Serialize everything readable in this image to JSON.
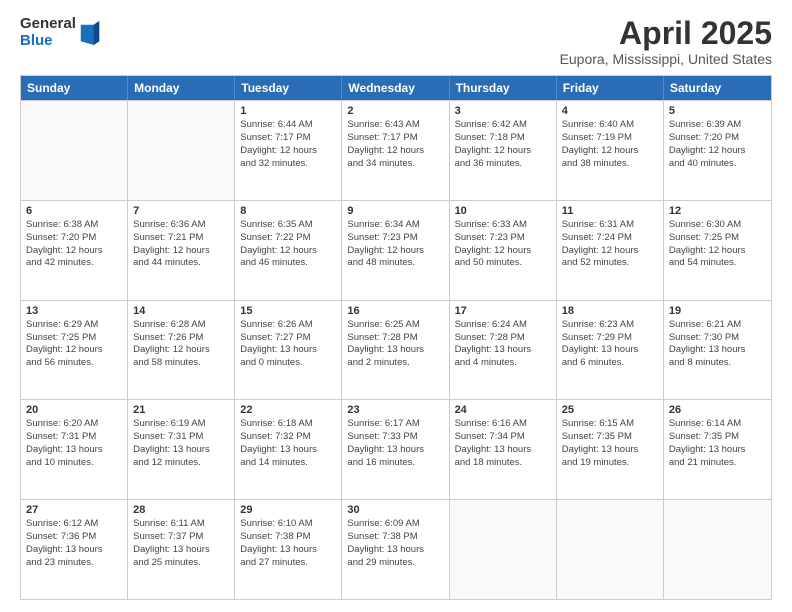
{
  "header": {
    "logo_general": "General",
    "logo_blue": "Blue",
    "title": "April 2025",
    "subtitle": "Eupora, Mississippi, United States"
  },
  "calendar": {
    "days_of_week": [
      "Sunday",
      "Monday",
      "Tuesday",
      "Wednesday",
      "Thursday",
      "Friday",
      "Saturday"
    ],
    "rows": [
      [
        {
          "day": "",
          "info": ""
        },
        {
          "day": "",
          "info": ""
        },
        {
          "day": "1",
          "info": "Sunrise: 6:44 AM\nSunset: 7:17 PM\nDaylight: 12 hours\nand 32 minutes."
        },
        {
          "day": "2",
          "info": "Sunrise: 6:43 AM\nSunset: 7:17 PM\nDaylight: 12 hours\nand 34 minutes."
        },
        {
          "day": "3",
          "info": "Sunrise: 6:42 AM\nSunset: 7:18 PM\nDaylight: 12 hours\nand 36 minutes."
        },
        {
          "day": "4",
          "info": "Sunrise: 6:40 AM\nSunset: 7:19 PM\nDaylight: 12 hours\nand 38 minutes."
        },
        {
          "day": "5",
          "info": "Sunrise: 6:39 AM\nSunset: 7:20 PM\nDaylight: 12 hours\nand 40 minutes."
        }
      ],
      [
        {
          "day": "6",
          "info": "Sunrise: 6:38 AM\nSunset: 7:20 PM\nDaylight: 12 hours\nand 42 minutes."
        },
        {
          "day": "7",
          "info": "Sunrise: 6:36 AM\nSunset: 7:21 PM\nDaylight: 12 hours\nand 44 minutes."
        },
        {
          "day": "8",
          "info": "Sunrise: 6:35 AM\nSunset: 7:22 PM\nDaylight: 12 hours\nand 46 minutes."
        },
        {
          "day": "9",
          "info": "Sunrise: 6:34 AM\nSunset: 7:23 PM\nDaylight: 12 hours\nand 48 minutes."
        },
        {
          "day": "10",
          "info": "Sunrise: 6:33 AM\nSunset: 7:23 PM\nDaylight: 12 hours\nand 50 minutes."
        },
        {
          "day": "11",
          "info": "Sunrise: 6:31 AM\nSunset: 7:24 PM\nDaylight: 12 hours\nand 52 minutes."
        },
        {
          "day": "12",
          "info": "Sunrise: 6:30 AM\nSunset: 7:25 PM\nDaylight: 12 hours\nand 54 minutes."
        }
      ],
      [
        {
          "day": "13",
          "info": "Sunrise: 6:29 AM\nSunset: 7:25 PM\nDaylight: 12 hours\nand 56 minutes."
        },
        {
          "day": "14",
          "info": "Sunrise: 6:28 AM\nSunset: 7:26 PM\nDaylight: 12 hours\nand 58 minutes."
        },
        {
          "day": "15",
          "info": "Sunrise: 6:26 AM\nSunset: 7:27 PM\nDaylight: 13 hours\nand 0 minutes."
        },
        {
          "day": "16",
          "info": "Sunrise: 6:25 AM\nSunset: 7:28 PM\nDaylight: 13 hours\nand 2 minutes."
        },
        {
          "day": "17",
          "info": "Sunrise: 6:24 AM\nSunset: 7:28 PM\nDaylight: 13 hours\nand 4 minutes."
        },
        {
          "day": "18",
          "info": "Sunrise: 6:23 AM\nSunset: 7:29 PM\nDaylight: 13 hours\nand 6 minutes."
        },
        {
          "day": "19",
          "info": "Sunrise: 6:21 AM\nSunset: 7:30 PM\nDaylight: 13 hours\nand 8 minutes."
        }
      ],
      [
        {
          "day": "20",
          "info": "Sunrise: 6:20 AM\nSunset: 7:31 PM\nDaylight: 13 hours\nand 10 minutes."
        },
        {
          "day": "21",
          "info": "Sunrise: 6:19 AM\nSunset: 7:31 PM\nDaylight: 13 hours\nand 12 minutes."
        },
        {
          "day": "22",
          "info": "Sunrise: 6:18 AM\nSunset: 7:32 PM\nDaylight: 13 hours\nand 14 minutes."
        },
        {
          "day": "23",
          "info": "Sunrise: 6:17 AM\nSunset: 7:33 PM\nDaylight: 13 hours\nand 16 minutes."
        },
        {
          "day": "24",
          "info": "Sunrise: 6:16 AM\nSunset: 7:34 PM\nDaylight: 13 hours\nand 18 minutes."
        },
        {
          "day": "25",
          "info": "Sunrise: 6:15 AM\nSunset: 7:35 PM\nDaylight: 13 hours\nand 19 minutes."
        },
        {
          "day": "26",
          "info": "Sunrise: 6:14 AM\nSunset: 7:35 PM\nDaylight: 13 hours\nand 21 minutes."
        }
      ],
      [
        {
          "day": "27",
          "info": "Sunrise: 6:12 AM\nSunset: 7:36 PM\nDaylight: 13 hours\nand 23 minutes."
        },
        {
          "day": "28",
          "info": "Sunrise: 6:11 AM\nSunset: 7:37 PM\nDaylight: 13 hours\nand 25 minutes."
        },
        {
          "day": "29",
          "info": "Sunrise: 6:10 AM\nSunset: 7:38 PM\nDaylight: 13 hours\nand 27 minutes."
        },
        {
          "day": "30",
          "info": "Sunrise: 6:09 AM\nSunset: 7:38 PM\nDaylight: 13 hours\nand 29 minutes."
        },
        {
          "day": "",
          "info": ""
        },
        {
          "day": "",
          "info": ""
        },
        {
          "day": "",
          "info": ""
        }
      ]
    ]
  }
}
